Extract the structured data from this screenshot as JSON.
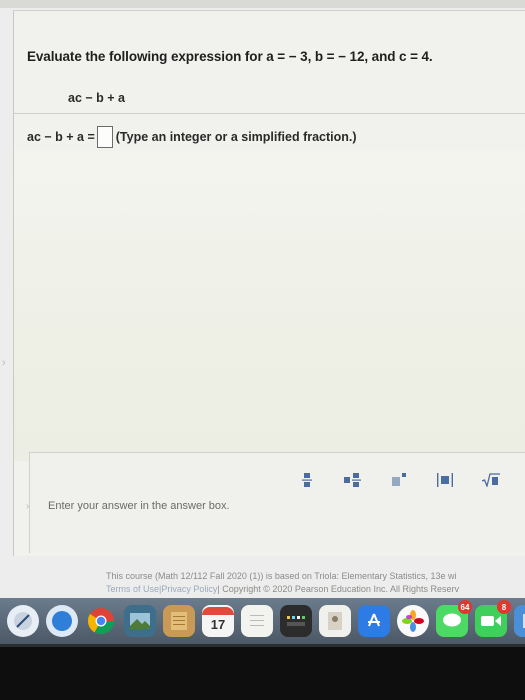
{
  "question": {
    "prompt": "Evaluate the following expression for a = − 3, b = − 12, and c = 4.",
    "expression": "ac − b + a"
  },
  "answer": {
    "lhs": "ac − b + a =",
    "input_value": "",
    "hint": "(Type an integer or a simplified fraction.)"
  },
  "palette": {
    "tools": [
      {
        "name": "fraction-tool",
        "icon": "fraction-icon"
      },
      {
        "name": "mixed-number-tool",
        "icon": "mixed-number-icon"
      },
      {
        "name": "exponent-tool",
        "icon": "exponent-icon"
      },
      {
        "name": "absolute-value-tool",
        "icon": "absolute-value-icon"
      },
      {
        "name": "square-root-tool",
        "icon": "square-root-icon"
      },
      {
        "name": "nth-root-tool",
        "icon": "nth-root-icon"
      }
    ],
    "status": "Enter your answer in the answer box."
  },
  "footer": {
    "line1": "This course (Math 12/112 Fall 2020 (1)) is based on Triola: Elementary Statistics, 13e wi",
    "terms_link": "Terms of Use",
    "privacy_link": "Privacy Policy",
    "line2": "| Copyright © 2020 Pearson Education Inc. All Rights Reserv"
  },
  "dock": {
    "calendar_day": "17",
    "badges": [
      "64",
      "8"
    ]
  },
  "colors": {
    "panel": "#f1f2ee",
    "palette_icon": "#4b6c9e",
    "dock": "#5a6878"
  }
}
